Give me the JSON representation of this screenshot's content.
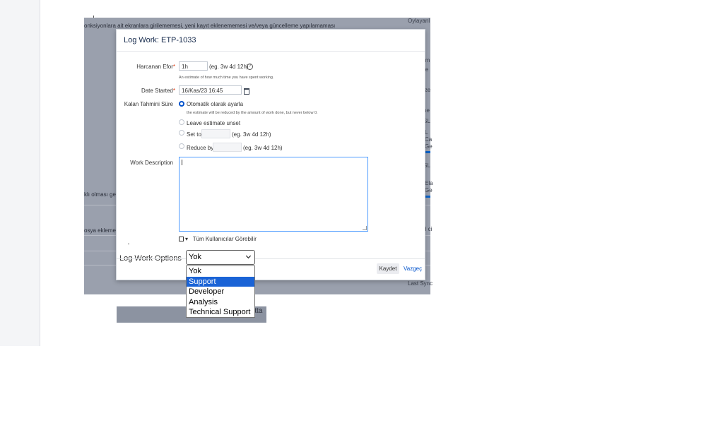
{
  "background": {
    "line1": "onksiyonlara ait ekranlara girilememesi, yeni kayıt eklenememesi ve/veya güncelleme yapılamaması",
    "line2": "klı olması ge",
    "line3": "osya eklemek",
    "below_text": "itta"
  },
  "right_strip": {
    "t1": "Oylayanl",
    "t2": "r",
    "t3": "rm",
    "t4": "re",
    "t5": "ize",
    "t6": "ne",
    "t7": "SL",
    "t8": "L",
    "t9": "Ca",
    "t10": "Ge",
    "t11": "SL",
    "t12": "Ela",
    "t13": "Ge",
    "t14": "d ci",
    "t15": "Last Sync"
  },
  "modal": {
    "title": "Log Work: ETP-1033",
    "effort_label": "Harcanan Efor",
    "effort_value": "1h",
    "effort_example": "(eg. 3w 4d 12h)",
    "effort_hint": "An estimate of how much time you have spent working.",
    "date_label": "Date Started",
    "date_value": "16/Kas/23 16:45",
    "remaining_label": "Kalan Tahmini Süre",
    "radio_auto": "Otomatik olarak ayarla",
    "radio_auto_hint": "the estimate will be reduced by the amount of work done, but never below 0.",
    "radio_unset": "Leave estimate unset",
    "radio_set": "Set to",
    "radio_set_example": "(eg. 3w 4d 12h)",
    "radio_reduce": "Reduce by",
    "radio_reduce_example": "(eg. 3w 4d 12h)",
    "desc_label": "Work Description",
    "visibility": "Tüm Kullanıcılar Görebilir",
    "options_label": "Log Work Options",
    "save": "Kaydet",
    "cancel": "Vazgeç"
  },
  "select": {
    "selected": "Yok",
    "options": [
      "Yok",
      "Support",
      "Developer",
      "Analysis",
      "Technical Support"
    ]
  },
  "colors": {
    "accent": "#0052cc",
    "selected_option_bg": "#1a63d6",
    "required": "#de350b"
  }
}
